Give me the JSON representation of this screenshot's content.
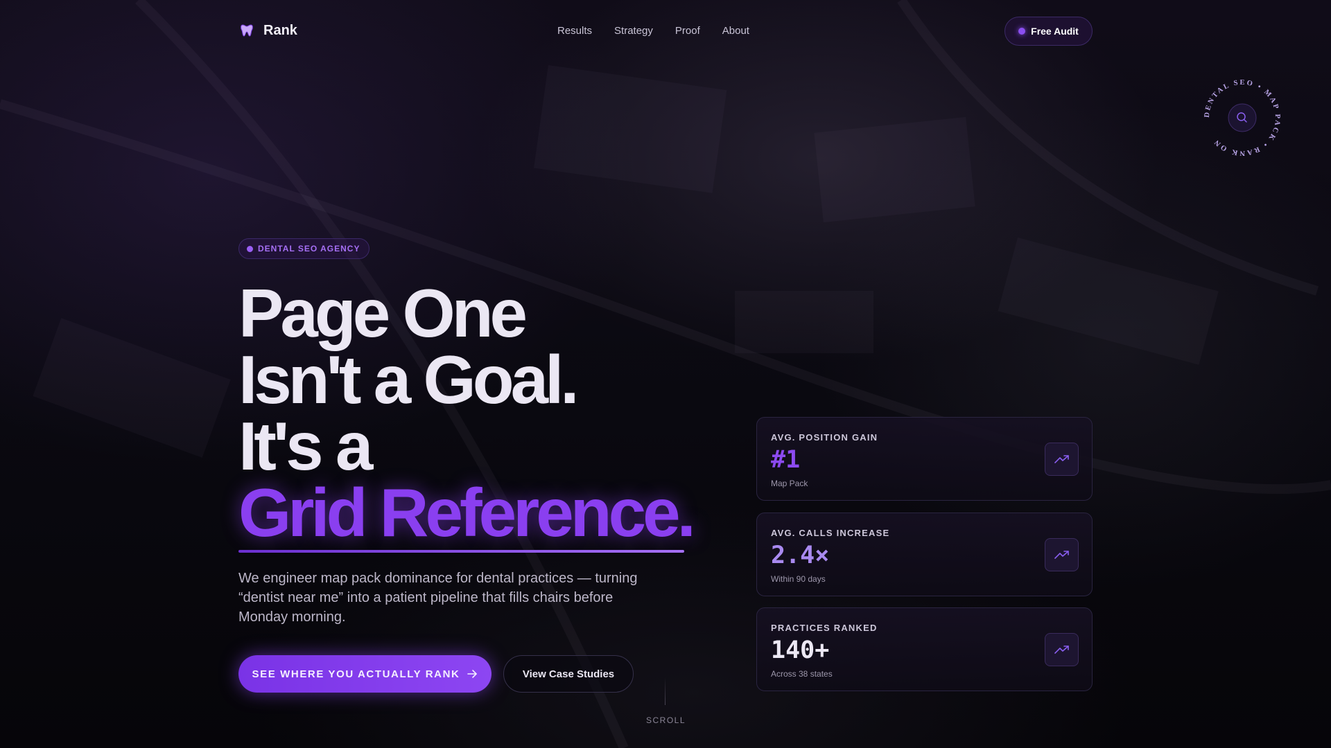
{
  "nav": {
    "brand": "Rank",
    "links": [
      "Results",
      "Strategy",
      "Proof",
      "About"
    ],
    "cta": "Free Audit"
  },
  "badge": {
    "ring_text": "DENTAL SEO • MAP PACK • RANK ON ",
    "icon": "search-icon"
  },
  "hero": {
    "tag": "DENTAL SEO AGENCY",
    "headline_lines": [
      "Page One",
      "Isn't a Goal.",
      "It's a"
    ],
    "headline_accent": "Grid Reference.",
    "subcopy": "We engineer map pack dominance for dental practices — turning “dentist near me” into a patient pipeline that fills chairs before Monday morning.",
    "cta_primary": "SEE WHERE YOU ACTUALLY RANK",
    "cta_secondary": "View Case Studies",
    "scroll": "SCROLL"
  },
  "stats": [
    {
      "label": "AVG. POSITION GAIN",
      "value": "#1",
      "sub": "Map Pack",
      "value_color": "#8c4af0",
      "icon": "trending-up-icon"
    },
    {
      "label": "AVG. CALLS INCREASE",
      "value": "2.4×",
      "sub": "Within 90 days",
      "value_color": "#a98af0",
      "icon": "trending-up-icon"
    },
    {
      "label": "PRACTICES RANKED",
      "value": "140+",
      "sub": "Across 38 states",
      "value_color": "#ece8f4",
      "icon": "trending-up-icon"
    }
  ],
  "colors": {
    "accent": "#8a3ff0",
    "background": "#07060b"
  }
}
